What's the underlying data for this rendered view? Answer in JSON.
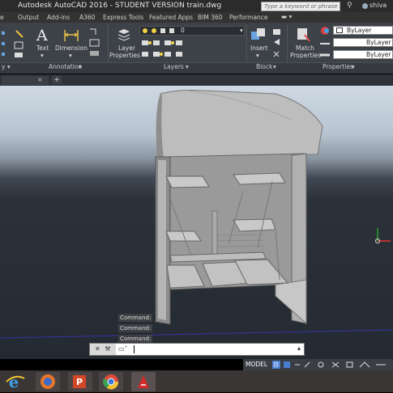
{
  "window": {
    "title": "Autodesk AutoCAD 2016 - STUDENT VERSION    train.dwg",
    "search_placeholder": "Type a keyword or phrase",
    "user": "shiva"
  },
  "tabs": [
    "Output",
    "Add-ins",
    "A360",
    "Express Tools",
    "Featured Apps",
    "BIM 360",
    "Performance"
  ],
  "ribbon": {
    "annotation": {
      "text_label": "Text",
      "dimension_label": "Dimension",
      "panel": "Annotation"
    },
    "layers": {
      "layer_props_line1": "Layer",
      "layer_props_line2": "Properties",
      "current_layer": "0",
      "panel": "Layers"
    },
    "block": {
      "insert_label": "Insert",
      "panel": "Block"
    },
    "properties": {
      "match_line1": "Match",
      "match_line2": "Properties",
      "color": "ByLayer",
      "linetype": "ByLayer",
      "lineweight": "ByLayer",
      "panel": "Properties"
    }
  },
  "command": {
    "history": [
      "Command:",
      "Command:",
      "Command:"
    ],
    "input_value": ""
  },
  "status": {
    "model_label": "MODEL"
  },
  "colors": {
    "ribbon_bg": "#3d4148",
    "viewport_top": "#cfd9e3",
    "ucs_red": "#e83030",
    "ucs_green": "#2ea02e"
  }
}
